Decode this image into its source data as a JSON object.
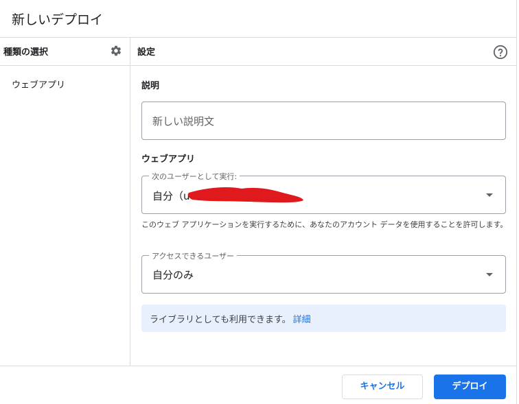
{
  "dialog": {
    "title": "新しいデプロイ"
  },
  "sidebar": {
    "heading": "種類の選択",
    "items": [
      {
        "label": "ウェブアプリ"
      }
    ]
  },
  "settings": {
    "heading": "設定",
    "description_label": "説明",
    "description_placeholder": "新しい説明文",
    "webapp_label": "ウェブアプリ",
    "execute_as": {
      "legend": "次のユーザーとして実行:",
      "value": "自分（u"
    },
    "help_text": "このウェブ アプリケーションを実行するために、あなたのアカウント データを使用することを許可します。",
    "access": {
      "legend": "アクセスできるユーザー",
      "value": "自分のみ"
    },
    "library_notice": {
      "text": "ライブラリとしても利用できます。",
      "link": "詳細"
    }
  },
  "footer": {
    "cancel_label": "キャンセル",
    "deploy_label": "デプロイ"
  },
  "icons": {
    "settings": "gear-icon",
    "help": "help-icon",
    "dropdown": "chevron-down-icon"
  },
  "colors": {
    "accent": "#1a73e8",
    "notice_bg": "#e8f0fe",
    "redaction": "#e0191d"
  }
}
